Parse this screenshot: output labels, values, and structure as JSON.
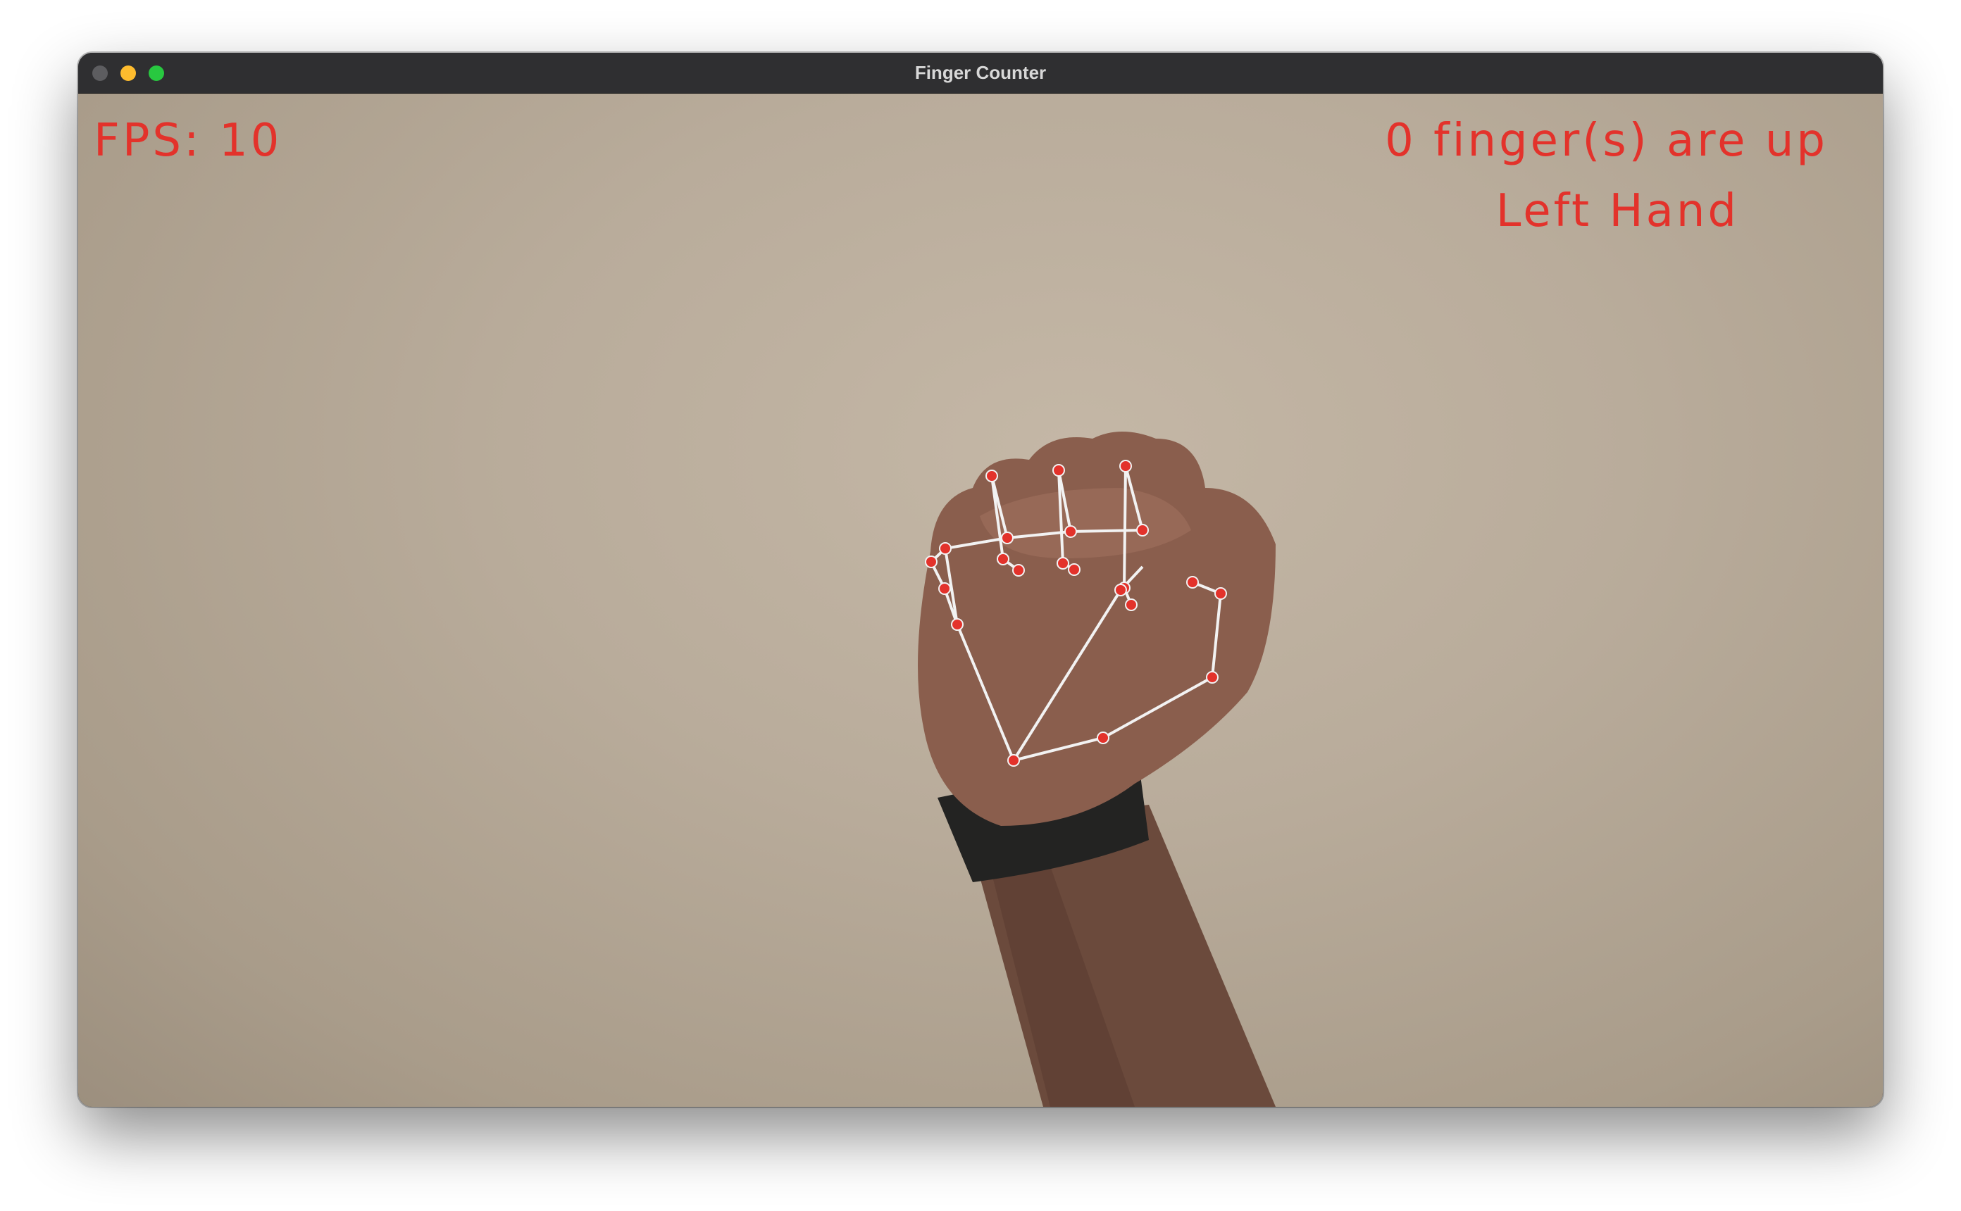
{
  "window": {
    "title": "Finger Counter"
  },
  "overlay": {
    "fps_text": "FPS: 10",
    "finger_count_text": "0 finger(s) are up",
    "hand_text": "Left Hand",
    "text_color": "#e3322b"
  },
  "landmarks": {
    "point_color": "#e3322b",
    "connection_color": "#f2f2f2"
  },
  "icons": {
    "close": "close-dot-icon",
    "minimize": "minimize-dot-icon",
    "zoom": "zoom-dot-icon"
  }
}
